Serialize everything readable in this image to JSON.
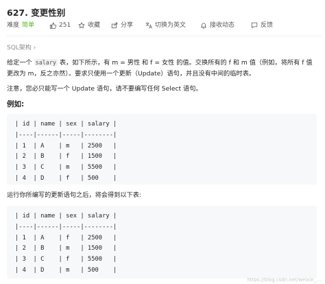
{
  "problem": {
    "title": "627. 变更性别"
  },
  "meta": {
    "difficulty_label": "难度",
    "difficulty_value": "简单",
    "like_count": "251",
    "favorite_label": "收藏",
    "share_label": "分享",
    "switch_lang_label": "切换为英文",
    "notify_label": "接收动态",
    "feedback_label": "反馈"
  },
  "tag": "SQL架构 ›",
  "description": {
    "p1_before": "给定一个 ",
    "p1_code": "salary",
    "p1_after": " 表，如下所示，有 m = 男性 和 f = 女性 的值。交换所有的 f 和 m 值（例如，将所有 f 值更改为 m，反之亦然）。要求只使用一个更新（Update）语句，并且没有中间的临时表。",
    "p2": "注意，您必只能写一个 Update 语句，请不要编写任何 Select 语句。",
    "example_label": "例如:",
    "table_before": "| id | name | sex | salary |\n|----|------|-----|--------|\n| 1  | A    | m   | 2500   |\n| 2  | B    | f   | 1500   |\n| 3  | C    | m   | 5500   |\n| 4  | D    | f   | 500    |",
    "p3": "运行你所编写的更新语句之后，将会得到以下表:",
    "table_after": "| id | name | sex | salary |\n|----|------|-----|--------|\n| 1  | A    | f   | 2500   |\n| 2  | B    | m   | 1500   |\n| 3  | C    | f   | 5500   |\n| 4  | D    | m   | 500    |"
  },
  "watermark": "https://blog.csdn.net/weixin_..."
}
